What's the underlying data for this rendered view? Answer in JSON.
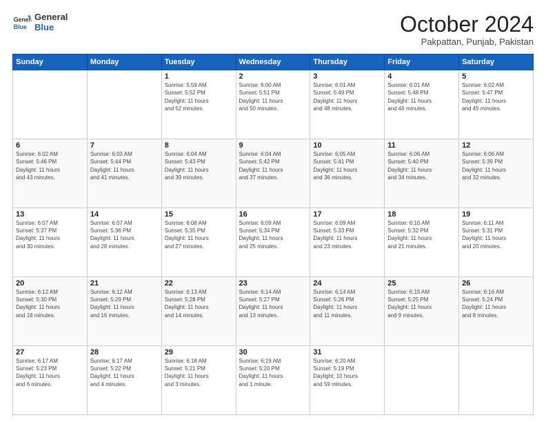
{
  "header": {
    "logo_line1": "General",
    "logo_line2": "Blue",
    "month": "October 2024",
    "location": "Pakpattan, Punjab, Pakistan"
  },
  "weekdays": [
    "Sunday",
    "Monday",
    "Tuesday",
    "Wednesday",
    "Thursday",
    "Friday",
    "Saturday"
  ],
  "weeks": [
    [
      {
        "day": "",
        "info": ""
      },
      {
        "day": "",
        "info": ""
      },
      {
        "day": "1",
        "info": "Sunrise: 5:59 AM\nSunset: 5:52 PM\nDaylight: 11 hours\nand 52 minutes."
      },
      {
        "day": "2",
        "info": "Sunrise: 6:00 AM\nSunset: 5:51 PM\nDaylight: 11 hours\nand 50 minutes."
      },
      {
        "day": "3",
        "info": "Sunrise: 6:01 AM\nSunset: 5:49 PM\nDaylight: 11 hours\nand 48 minutes."
      },
      {
        "day": "4",
        "info": "Sunrise: 6:01 AM\nSunset: 5:48 PM\nDaylight: 11 hours\nand 46 minutes."
      },
      {
        "day": "5",
        "info": "Sunrise: 6:02 AM\nSunset: 5:47 PM\nDaylight: 11 hours\nand 45 minutes."
      }
    ],
    [
      {
        "day": "6",
        "info": "Sunrise: 6:02 AM\nSunset: 5:46 PM\nDaylight: 11 hours\nand 43 minutes."
      },
      {
        "day": "7",
        "info": "Sunrise: 6:03 AM\nSunset: 5:44 PM\nDaylight: 11 hours\nand 41 minutes."
      },
      {
        "day": "8",
        "info": "Sunrise: 6:04 AM\nSunset: 5:43 PM\nDaylight: 11 hours\nand 39 minutes."
      },
      {
        "day": "9",
        "info": "Sunrise: 6:04 AM\nSunset: 5:42 PM\nDaylight: 11 hours\nand 37 minutes."
      },
      {
        "day": "10",
        "info": "Sunrise: 6:05 AM\nSunset: 5:41 PM\nDaylight: 11 hours\nand 36 minutes."
      },
      {
        "day": "11",
        "info": "Sunrise: 6:06 AM\nSunset: 5:40 PM\nDaylight: 11 hours\nand 34 minutes."
      },
      {
        "day": "12",
        "info": "Sunrise: 6:06 AM\nSunset: 5:39 PM\nDaylight: 11 hours\nand 32 minutes."
      }
    ],
    [
      {
        "day": "13",
        "info": "Sunrise: 6:07 AM\nSunset: 5:37 PM\nDaylight: 11 hours\nand 30 minutes."
      },
      {
        "day": "14",
        "info": "Sunrise: 6:07 AM\nSunset: 5:36 PM\nDaylight: 11 hours\nand 28 minutes."
      },
      {
        "day": "15",
        "info": "Sunrise: 6:08 AM\nSunset: 5:35 PM\nDaylight: 11 hours\nand 27 minutes."
      },
      {
        "day": "16",
        "info": "Sunrise: 6:09 AM\nSunset: 5:34 PM\nDaylight: 11 hours\nand 25 minutes."
      },
      {
        "day": "17",
        "info": "Sunrise: 6:09 AM\nSunset: 5:33 PM\nDaylight: 11 hours\nand 23 minutes."
      },
      {
        "day": "18",
        "info": "Sunrise: 6:10 AM\nSunset: 5:32 PM\nDaylight: 11 hours\nand 21 minutes."
      },
      {
        "day": "19",
        "info": "Sunrise: 6:11 AM\nSunset: 5:31 PM\nDaylight: 11 hours\nand 20 minutes."
      }
    ],
    [
      {
        "day": "20",
        "info": "Sunrise: 6:12 AM\nSunset: 5:30 PM\nDaylight: 11 hours\nand 18 minutes."
      },
      {
        "day": "21",
        "info": "Sunrise: 6:12 AM\nSunset: 5:29 PM\nDaylight: 11 hours\nand 16 minutes."
      },
      {
        "day": "22",
        "info": "Sunrise: 6:13 AM\nSunset: 5:28 PM\nDaylight: 11 hours\nand 14 minutes."
      },
      {
        "day": "23",
        "info": "Sunrise: 6:14 AM\nSunset: 5:27 PM\nDaylight: 11 hours\nand 13 minutes."
      },
      {
        "day": "24",
        "info": "Sunrise: 6:14 AM\nSunset: 5:26 PM\nDaylight: 11 hours\nand 11 minutes."
      },
      {
        "day": "25",
        "info": "Sunrise: 6:15 AM\nSunset: 5:25 PM\nDaylight: 11 hours\nand 9 minutes."
      },
      {
        "day": "26",
        "info": "Sunrise: 6:16 AM\nSunset: 5:24 PM\nDaylight: 11 hours\nand 8 minutes."
      }
    ],
    [
      {
        "day": "27",
        "info": "Sunrise: 6:17 AM\nSunset: 5:23 PM\nDaylight: 11 hours\nand 6 minutes."
      },
      {
        "day": "28",
        "info": "Sunrise: 6:17 AM\nSunset: 5:22 PM\nDaylight: 11 hours\nand 4 minutes."
      },
      {
        "day": "29",
        "info": "Sunrise: 6:18 AM\nSunset: 5:21 PM\nDaylight: 11 hours\nand 3 minutes."
      },
      {
        "day": "30",
        "info": "Sunrise: 6:19 AM\nSunset: 5:20 PM\nDaylight: 11 hours\nand 1 minute."
      },
      {
        "day": "31",
        "info": "Sunrise: 6:20 AM\nSunset: 5:19 PM\nDaylight: 10 hours\nand 59 minutes."
      },
      {
        "day": "",
        "info": ""
      },
      {
        "day": "",
        "info": ""
      }
    ]
  ]
}
